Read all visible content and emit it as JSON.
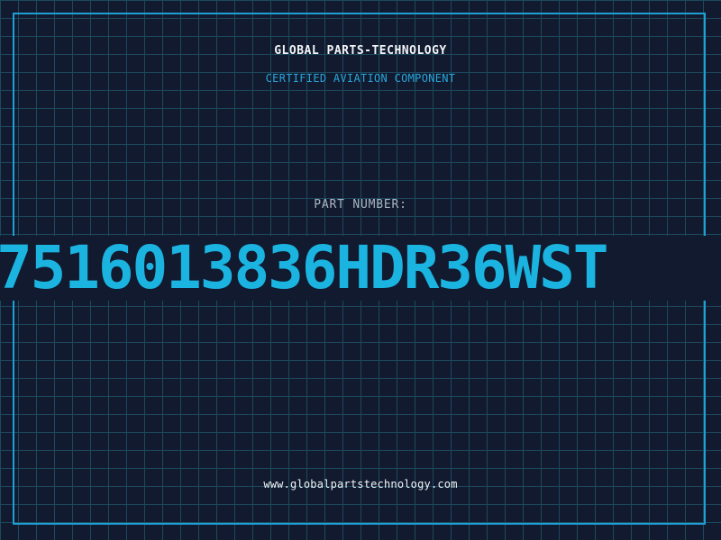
{
  "header": {
    "company_name": "GLOBAL PARTS-TECHNOLOGY",
    "tagline": "CERTIFIED AVIATION COMPONENT"
  },
  "part": {
    "label": "PART NUMBER:",
    "number": "7516013836HDR36WST"
  },
  "footer": {
    "website": "www.globalpartstechnology.com"
  },
  "colors": {
    "background": "#111a2e",
    "grid": "#1d4a5e",
    "accent": "#1bb3e0",
    "frame": "#1f9fd6",
    "text_primary": "#f2f5f8",
    "text_muted": "#aab6c4"
  }
}
